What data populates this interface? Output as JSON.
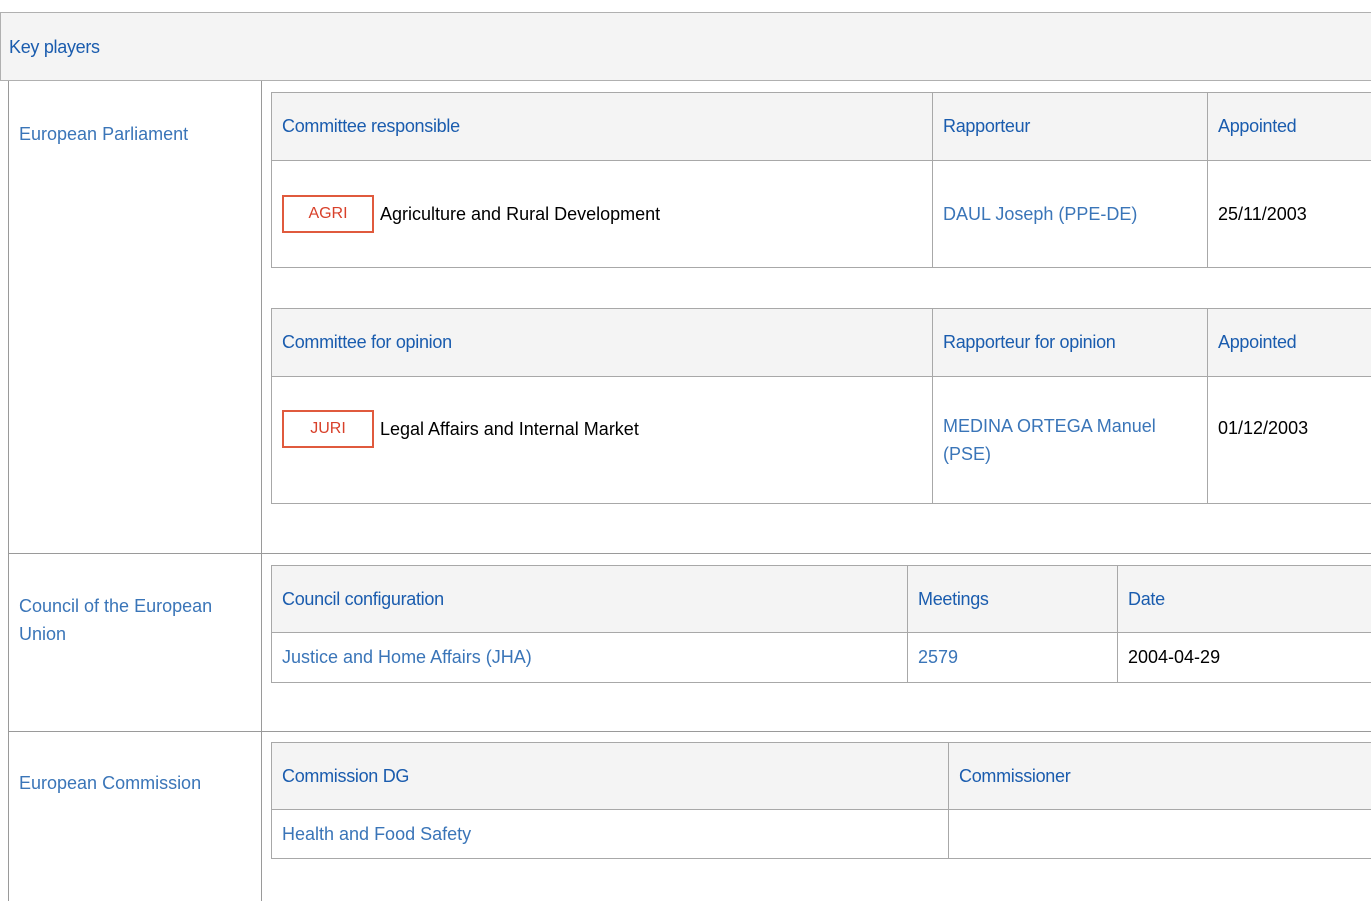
{
  "section_title": "Key players",
  "colors": {
    "link": "#3a75b8",
    "header_text": "#1a5cae",
    "badge": "#e05a3d"
  },
  "european_parliament": {
    "label": "European Parliament",
    "committee_responsible": {
      "headers": [
        "Committee responsible",
        "Rapporteur",
        "Appointed"
      ],
      "rows": [
        {
          "code": "AGRI",
          "name": "Agriculture and Rural Development",
          "rapporteur": "DAUL Joseph (PPE-DE)",
          "appointed": "25/11/2003"
        }
      ]
    },
    "committee_opinion": {
      "headers": [
        "Committee for opinion",
        "Rapporteur for opinion",
        "Appointed"
      ],
      "rows": [
        {
          "code": "JURI",
          "name": "Legal Affairs and Internal Market",
          "rapporteur": "MEDINA ORTEGA Manuel (PSE)",
          "appointed": "01/12/2003"
        }
      ]
    }
  },
  "council": {
    "label": "Council of the European Union",
    "headers": [
      "Council configuration",
      "Meetings",
      "Date"
    ],
    "rows": [
      {
        "configuration": "Justice and Home Affairs (JHA)",
        "meetings": "2579",
        "date": "2004-04-29"
      }
    ]
  },
  "commission": {
    "label": "European Commission",
    "headers": [
      "Commission DG",
      "Commissioner"
    ],
    "rows": [
      {
        "dg": "Health and Food Safety",
        "commissioner": ""
      }
    ]
  }
}
